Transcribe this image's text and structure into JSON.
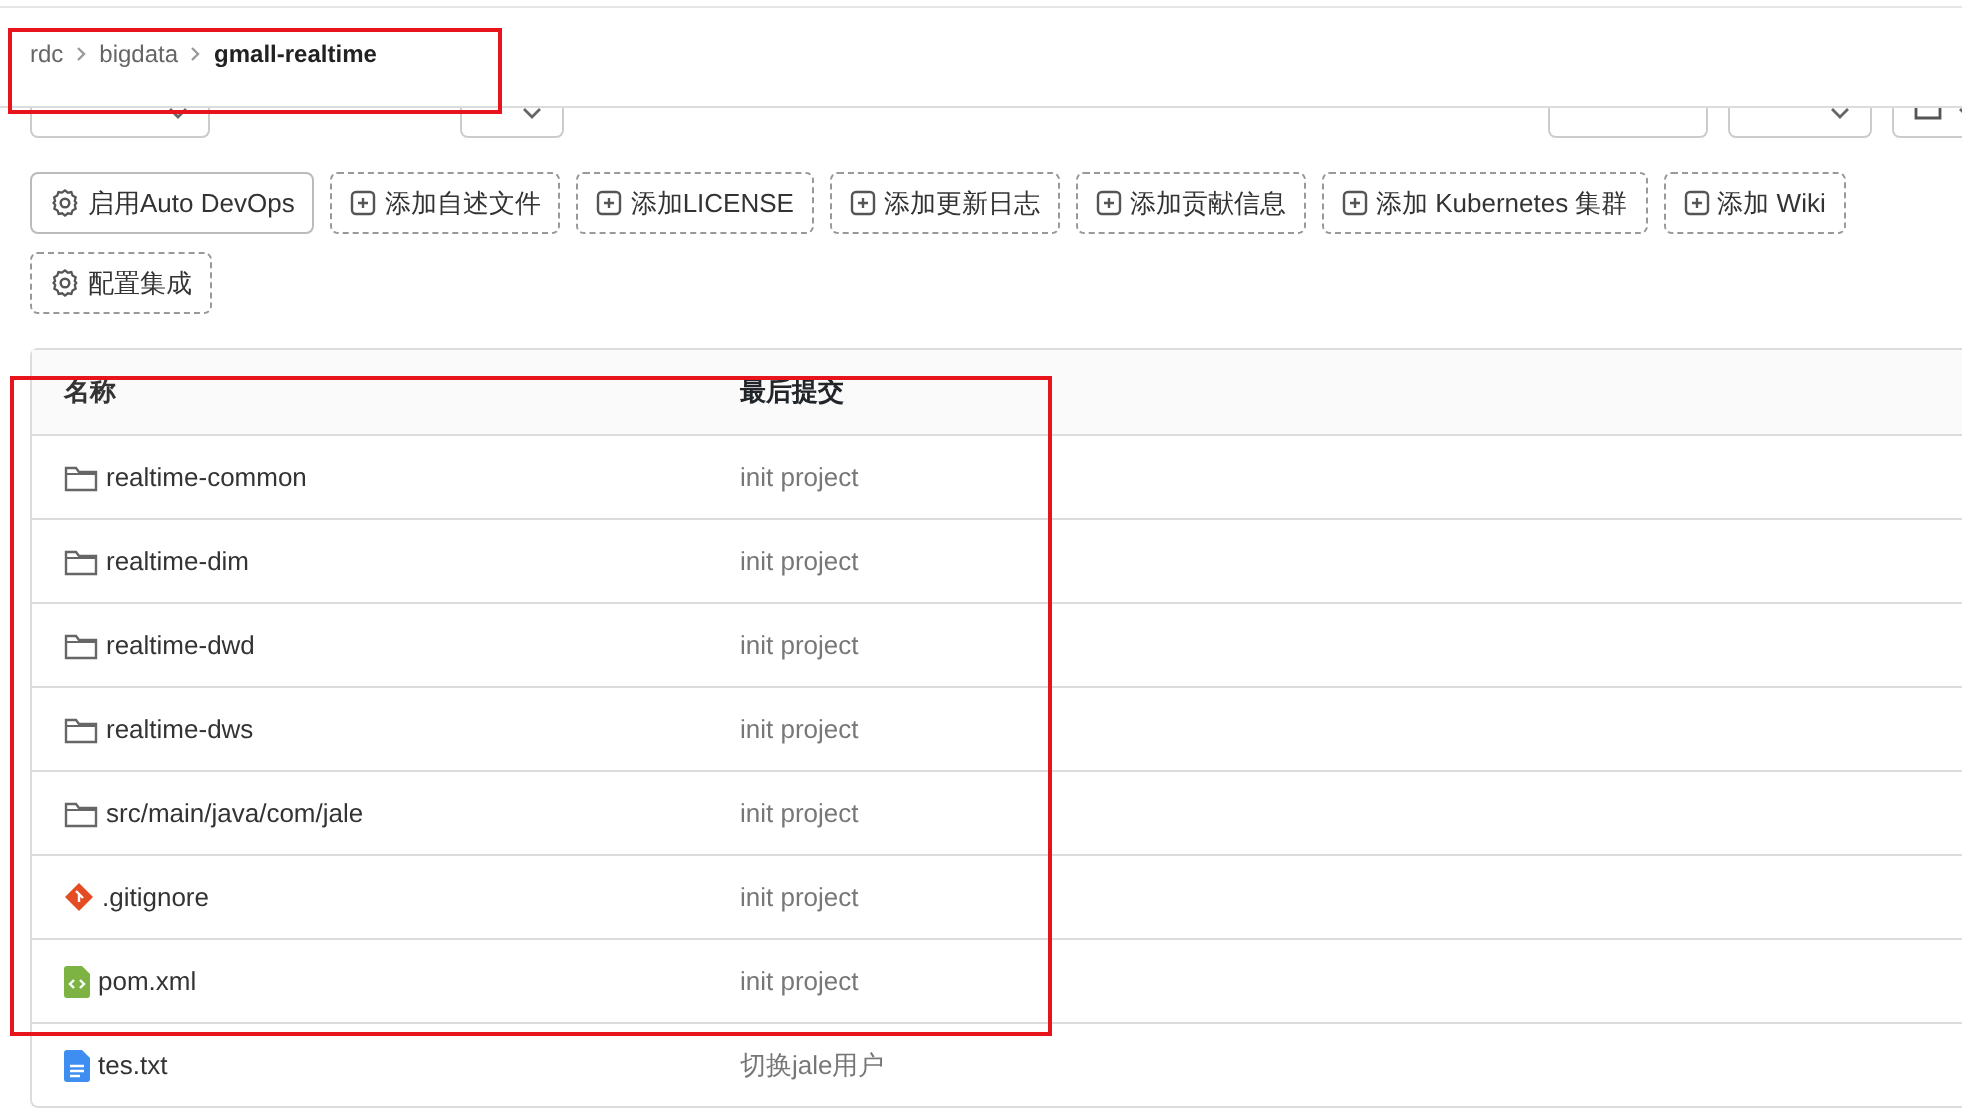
{
  "breadcrumb": [
    {
      "label": "rdc",
      "current": false
    },
    {
      "label": "bigdata",
      "current": false
    },
    {
      "label": "gmall-realtime",
      "current": true
    }
  ],
  "actions": [
    {
      "label": "启用Auto DevOps",
      "kind": "gear",
      "dashed": false
    },
    {
      "label": "添加自述文件",
      "kind": "plus",
      "dashed": true
    },
    {
      "label": "添加LICENSE",
      "kind": "plus",
      "dashed": true
    },
    {
      "label": "添加更新日志",
      "kind": "plus",
      "dashed": true
    },
    {
      "label": "添加贡献信息",
      "kind": "plus",
      "dashed": true
    },
    {
      "label": "添加 Kubernetes 集群",
      "kind": "plus",
      "dashed": true
    },
    {
      "label": "添加 Wiki",
      "kind": "plus",
      "dashed": true
    },
    {
      "label": "配置集成",
      "kind": "gear",
      "dashed": true
    }
  ],
  "table": {
    "columns": [
      "名称",
      "最后提交"
    ],
    "rows": [
      {
        "name": "realtime-common",
        "kind": "folder",
        "commit": "init project"
      },
      {
        "name": "realtime-dim",
        "kind": "folder",
        "commit": "init project"
      },
      {
        "name": "realtime-dwd",
        "kind": "folder",
        "commit": "init project"
      },
      {
        "name": "realtime-dws",
        "kind": "folder",
        "commit": "init project"
      },
      {
        "name": "src/main/java/com/jale",
        "kind": "folder",
        "commit": "init project"
      },
      {
        "name": ".gitignore",
        "kind": "git",
        "commit": "init project"
      },
      {
        "name": "pom.xml",
        "kind": "xml",
        "commit": "init project"
      },
      {
        "name": "tes.txt",
        "kind": "text",
        "commit": "切换jale用户"
      }
    ]
  },
  "highlight_boxes": [
    {
      "color": "#e8141c"
    },
    {
      "color": "#e8141c"
    }
  ]
}
